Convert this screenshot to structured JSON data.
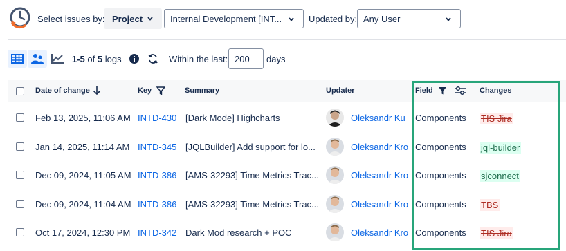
{
  "header": {
    "select_issues_label": "Select issues by:",
    "project_button": "Project",
    "project_select_value": "Internal Development [INT...",
    "updated_by_label": "Updated by:",
    "updated_by_value": "Any User"
  },
  "toolbar": {
    "count_range": "1-5",
    "count_of": "of",
    "count_total": "5",
    "count_suffix": "logs",
    "within_label": "Within the last:",
    "within_value": "200",
    "days_label": "days"
  },
  "table": {
    "columns": {
      "date": "Date of change",
      "key": "Key",
      "summary": "Summary",
      "updater": "Updater",
      "field": "Field",
      "changes": "Changes"
    },
    "rows": [
      {
        "date": "Feb 13, 2025, 11:06 AM",
        "key": "INTD-430",
        "summary": "[Dark Mode] Highcharts",
        "updater": "Oleksandr Ku",
        "field": "Components",
        "change": "TIS Jira",
        "change_type": "removed"
      },
      {
        "date": "Jan 14, 2025, 11:14 AM",
        "key": "INTD-345",
        "summary": "[JQLBuilder] Add support for lo...",
        "updater": "Oleksandr Kro",
        "field": "Components",
        "change": "jql-builder",
        "change_type": "added"
      },
      {
        "date": "Dec 09, 2024, 11:05 AM",
        "key": "INTD-386",
        "summary": "[AMS-32293] Time Metrics Trac...",
        "updater": "Oleksandr Kro",
        "field": "Components",
        "change": "sjconnect",
        "change_type": "added"
      },
      {
        "date": "Dec 09, 2024, 11:04 AM",
        "key": "INTD-386",
        "summary": "[AMS-32293] Time Metrics Trac...",
        "updater": "Oleksandr Kro",
        "field": "Components",
        "change": "TBS",
        "change_type": "removed"
      },
      {
        "date": "Oct 17, 2024, 12:30 PM",
        "key": "INTD-342",
        "summary": "Dark Mod research + POC",
        "updater": "Oleksandr Kro",
        "field": "Components",
        "change": "TIS Jira",
        "change_type": "removed"
      }
    ]
  },
  "colors": {
    "link": "#0c66e4",
    "highlight_border": "#28a57a",
    "added_bg": "#dcfff1",
    "removed_bg": "#ffeceb"
  },
  "icons": [
    "history-icon",
    "table-view-icon",
    "users-view-icon",
    "chart-view-icon",
    "info-icon",
    "refresh-icon",
    "sort-down-icon",
    "filter-icon",
    "sliders-icon",
    "chevron-down-icon"
  ]
}
